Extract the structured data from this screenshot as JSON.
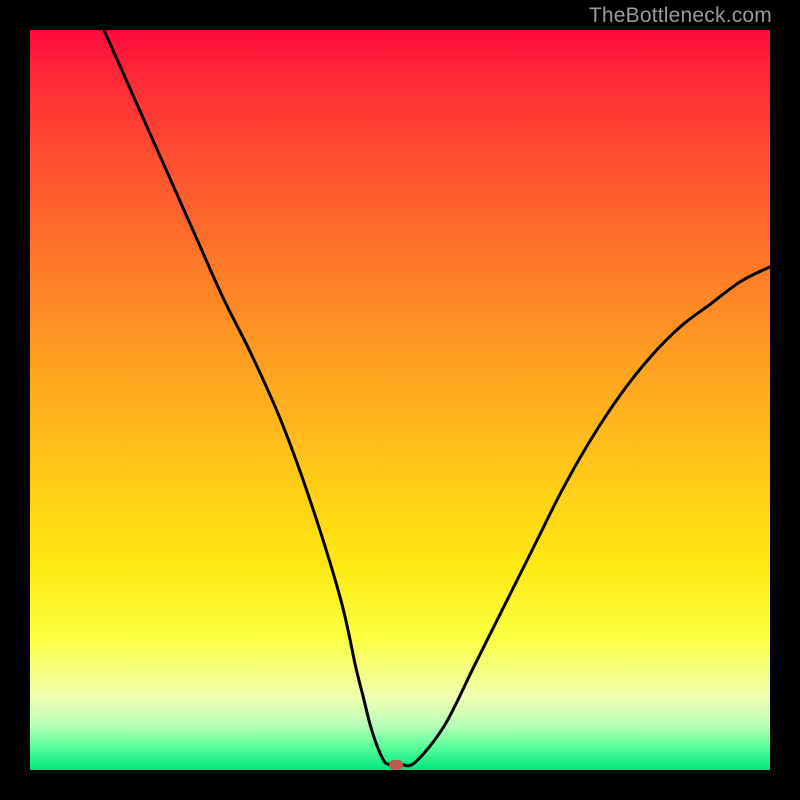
{
  "watermark": "TheBottleneck.com",
  "marker_color": "#c05a4a",
  "chart_data": {
    "type": "line",
    "title": "",
    "xlabel": "",
    "ylabel": "",
    "xlim": [
      0,
      100
    ],
    "ylim": [
      0,
      100
    ],
    "series": [
      {
        "name": "bottleneck-curve",
        "x": [
          10,
          14,
          18,
          22,
          26,
          30,
          34,
          38,
          42,
          44,
          45,
          46,
          47,
          48,
          49,
          50,
          52,
          56,
          60,
          64,
          68,
          72,
          76,
          80,
          84,
          88,
          92,
          96,
          100
        ],
        "y": [
          100,
          91,
          82,
          73,
          64,
          56,
          47,
          36,
          23,
          14,
          10,
          6,
          3,
          1,
          0.8,
          0.8,
          1,
          6,
          14,
          22,
          30,
          38,
          45,
          51,
          56,
          60,
          63,
          66,
          68
        ]
      }
    ],
    "annotations": [
      {
        "name": "optimal-marker",
        "x": 49.5,
        "y": 0.5
      }
    ]
  }
}
